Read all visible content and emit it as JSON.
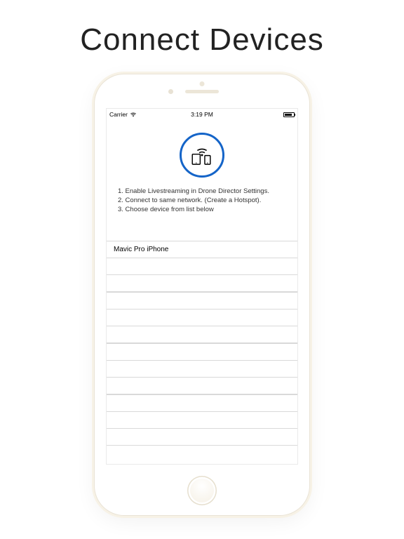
{
  "page": {
    "hero_title": "Connect Devices"
  },
  "status": {
    "carrier": "Carrier",
    "time": "3:19 PM"
  },
  "instructions": {
    "line1": "1. Enable Livestreaming in Drone Director Settings.",
    "line2": "2. Connect to same network. (Create a Hotspot).",
    "line3": "3. Choose device from list below"
  },
  "devices": {
    "item0": "Mavic Pro iPhone"
  },
  "icons": {
    "connect": "connect-devices-icon",
    "wifi": "wifi-icon",
    "battery": "battery-icon"
  }
}
